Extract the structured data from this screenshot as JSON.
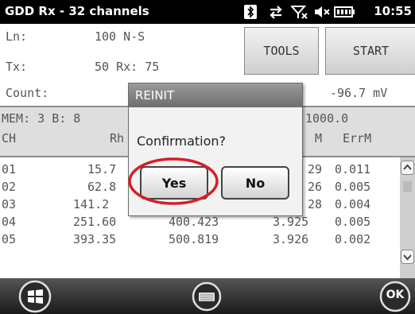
{
  "statusbar": {
    "title": "GDD Rx - 32 channels",
    "time": "10:55",
    "icons": [
      "bluetooth-icon",
      "data-sync-icon",
      "signal-off-icon",
      "volume-muted-icon",
      "battery-icon"
    ]
  },
  "info": {
    "ln_label": "Ln:",
    "ln_value": "100 N-S",
    "tx_label": "Tx:",
    "tx_value": "50 Rx: 75",
    "count_label": "Count:",
    "voltage": "-96.7 mV"
  },
  "buttons": {
    "tools": "TOOLS",
    "start": "START"
  },
  "mem": {
    "left": "MEM: 3 B: 8",
    "right": "1000.0"
  },
  "table": {
    "headers": {
      "ch": "CH",
      "rh": "Rh",
      "m": "M",
      "errm": "ErrM"
    },
    "rows": [
      {
        "ch": "01",
        "rh": "15.7",
        "mid": "",
        "m": "29",
        "errm": "0.011"
      },
      {
        "ch": "02",
        "rh": "62.8",
        "mid": "",
        "m": "26",
        "errm": "0.005"
      },
      {
        "ch": "03",
        "rh": "141.2",
        "mid": "",
        "m": "28",
        "errm": "0.004"
      },
      {
        "ch": "04",
        "rh": "251.60",
        "mid": "400.423",
        "m": "3.925",
        "errm": "0.005"
      },
      {
        "ch": "05",
        "rh": "393.35",
        "mid": "500.819",
        "m": "3.926",
        "errm": "0.002"
      }
    ]
  },
  "dialog": {
    "title": "REINIT",
    "message": "Confirmation?",
    "yes": "Yes",
    "no": "No"
  },
  "bottombar": {
    "ok": "OK",
    "icons": [
      "windows-start-icon",
      "keyboard-icon",
      "ok-icon"
    ]
  },
  "colors": {
    "highlight": "#d61f26",
    "panel": "#ffffff",
    "dialog_header": "#7a7a7a"
  }
}
